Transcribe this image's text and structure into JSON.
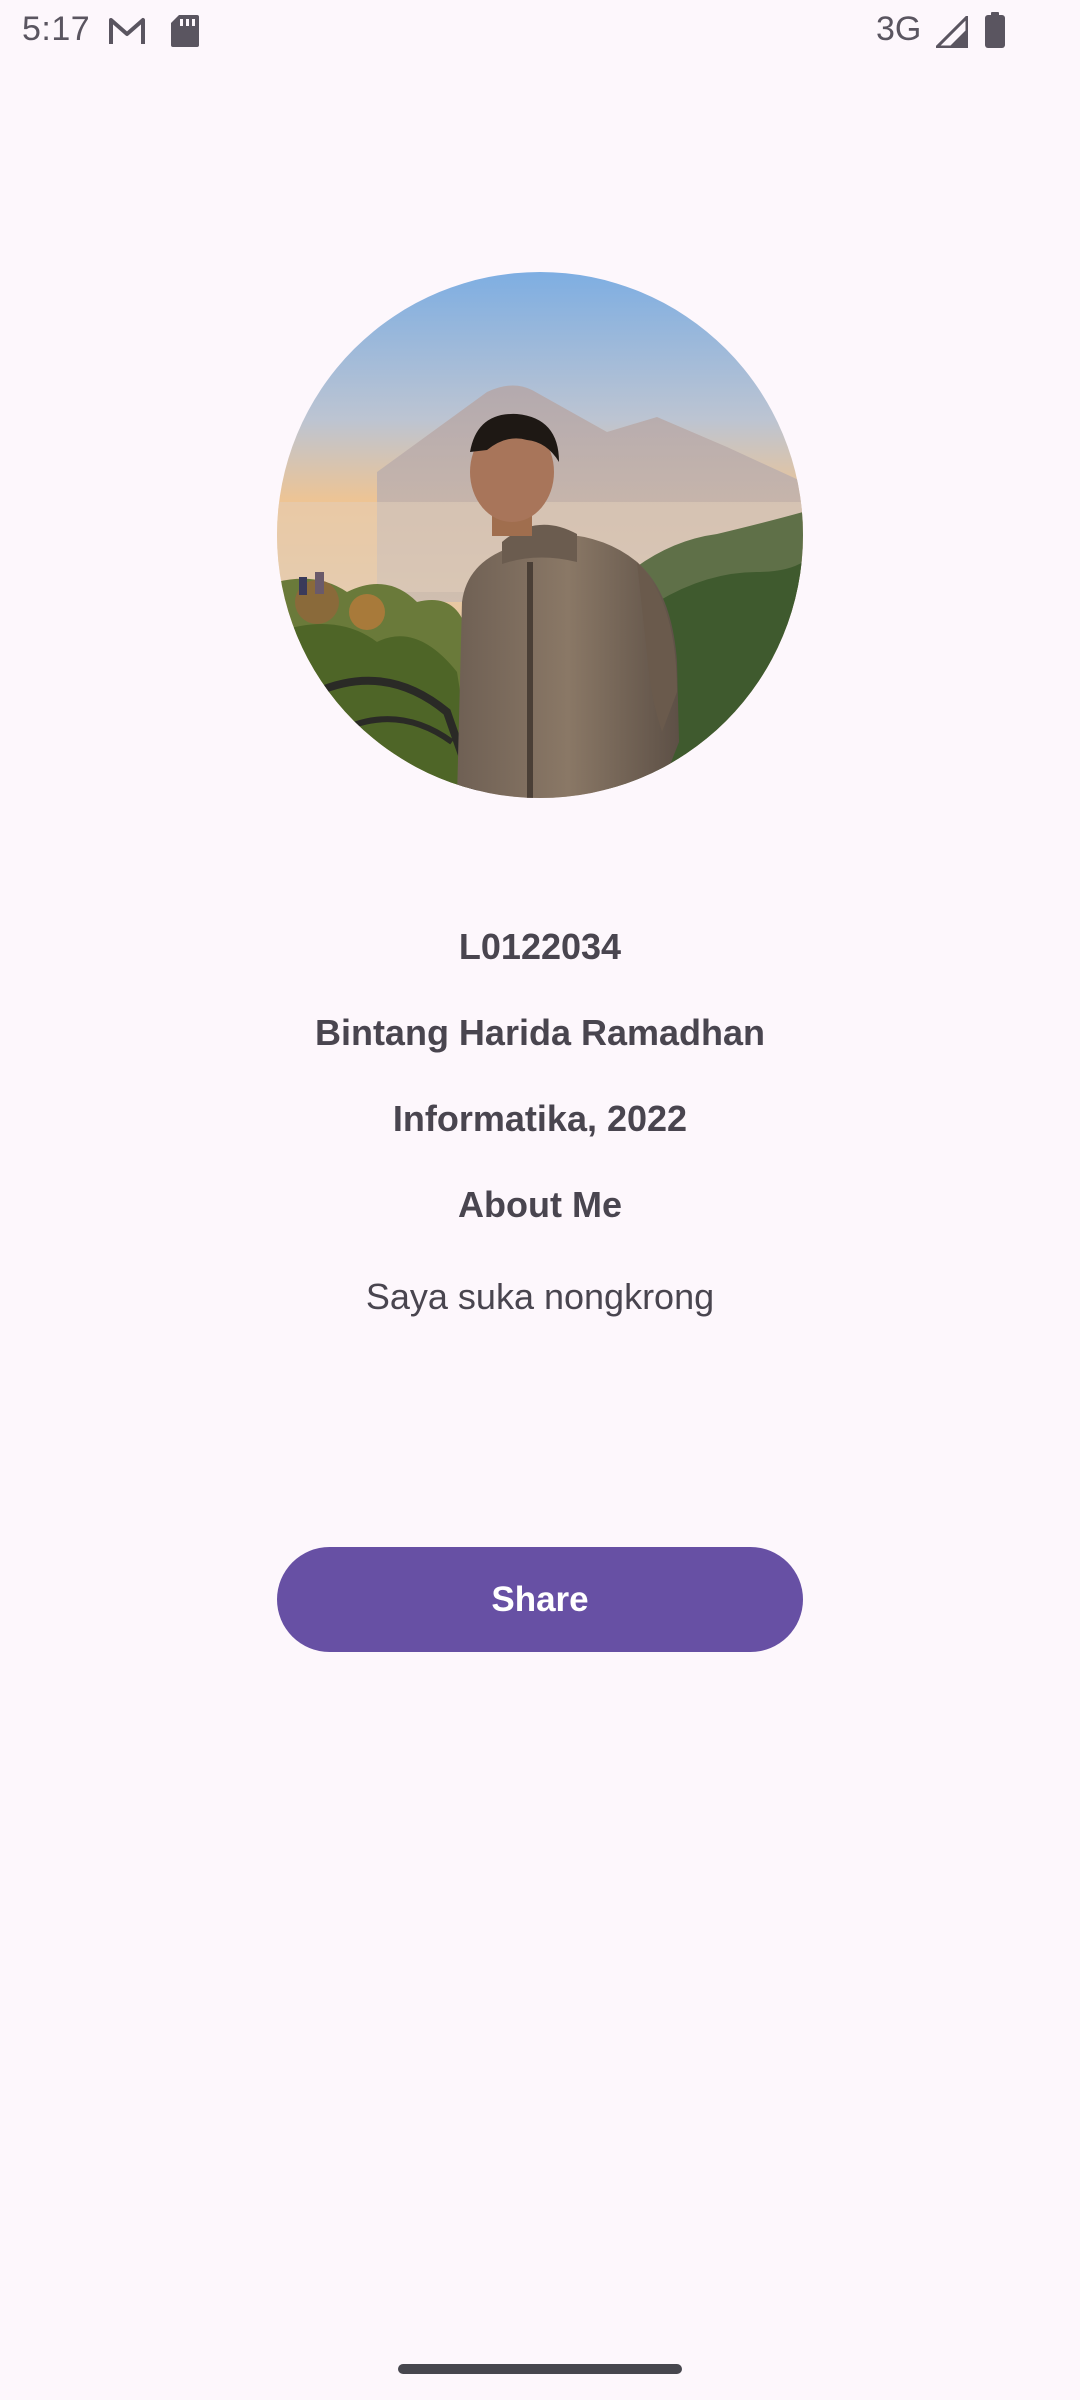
{
  "status_bar": {
    "time": "5:17",
    "network": "3G",
    "icons": [
      "gmail-icon",
      "sd-card-icon",
      "signal-icon",
      "battery-icon"
    ]
  },
  "profile": {
    "student_id": "L0122034",
    "name": "Bintang Harida Ramadhan",
    "program_year": "Informatika, 2022",
    "about_heading": "About Me",
    "about_text": "Saya suka nongkrong"
  },
  "actions": {
    "share_label": "Share"
  },
  "colors": {
    "background": "#fdf7fc",
    "primary": "#6750a4",
    "on_primary": "#ffffff",
    "text": "#49454f"
  }
}
